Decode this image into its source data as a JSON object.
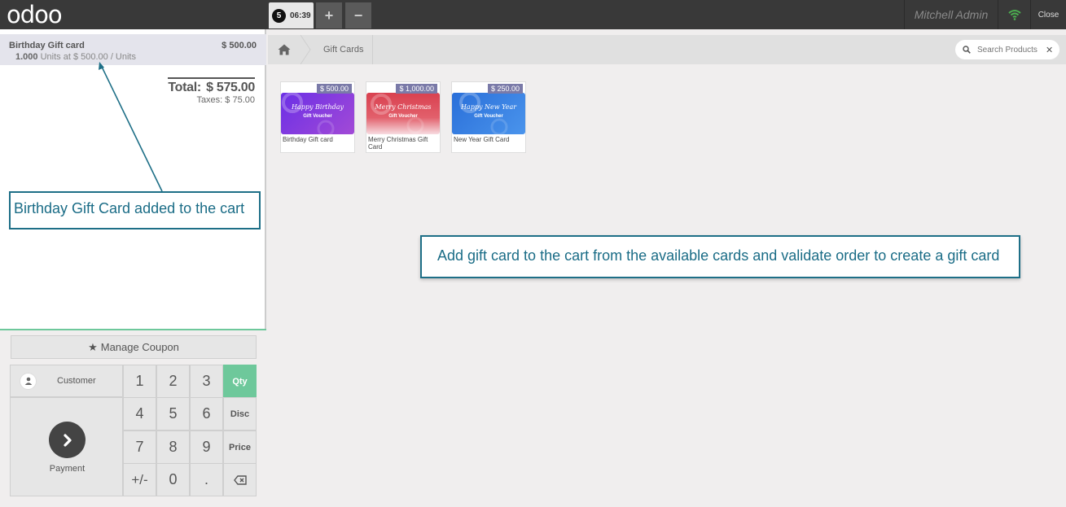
{
  "app": {
    "logo": "odoo"
  },
  "topbar": {
    "order_number": "5",
    "order_time": "06:39",
    "plus_label": "+",
    "minus_label": "−",
    "user_name": "Mitchell Admin",
    "close_label": "Close",
    "connection_icon": "wifi-icon"
  },
  "order": {
    "lines": [
      {
        "name": "Birthday Gift card",
        "price": "$ 500.00",
        "qty": "1.000",
        "detail": "Units at $ 500.00 / Units"
      }
    ],
    "total_label": "Total:",
    "total_value": "$ 575.00",
    "taxes": "Taxes: $ 75.00"
  },
  "controls": {
    "manage_coupon": "Manage Coupon",
    "customer": "Customer",
    "payment": "Payment",
    "keys": [
      "1",
      "2",
      "3",
      "4",
      "5",
      "6",
      "7",
      "8",
      "9",
      "+/-",
      "0",
      "."
    ],
    "modes": [
      "Qty",
      "Disc",
      "Price"
    ],
    "active_mode": "Qty",
    "backspace_icon": "backspace-icon"
  },
  "products_header": {
    "breadcrumb": "Gift Cards",
    "search_placeholder": "Search Products"
  },
  "products": [
    {
      "name": "Birthday Gift card",
      "price": "$ 500.00",
      "voucher_title": "Happy Birthday",
      "voucher_sub": "Gift Voucher",
      "color_top": "#7b3df0",
      "color_bottom": "#9b4ad8"
    },
    {
      "name": "Merry Christmas Gift Card",
      "price": "$ 1,000.00",
      "voucher_title": "Merry Christmas",
      "voucher_sub": "Gift Voucher",
      "color_top": "#e04a5a",
      "color_bottom": "#f7d6da"
    },
    {
      "name": "New Year Gift Card",
      "price": "$ 250.00",
      "voucher_title": "Happy New Year",
      "voucher_sub": "Gift Voucher",
      "color_top": "#2f7be0",
      "color_bottom": "#3f8ae8"
    }
  ],
  "annotations": {
    "left": "Birthday Gift Card added to the cart",
    "right": "Add gift card to the cart from the available cards and validate order to create a gift card"
  },
  "colors": {
    "accent_green": "#6ec89b",
    "topbar": "#393939",
    "callout_border": "#1e6f87"
  }
}
